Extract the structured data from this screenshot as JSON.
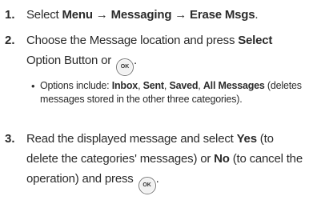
{
  "steps": [
    {
      "number": "1.",
      "prefix": "Select ",
      "path_bold": "Menu → Messaging → Erase Msgs",
      "suffix": "."
    },
    {
      "number": "2.",
      "line1_prefix": "Choose the Message location and press ",
      "line1_bold": "Select",
      "line2_text": "Option Button or ",
      "ok_label": "OK",
      "line2_suffix": ".",
      "bullet": {
        "intro": "Options include: ",
        "opt_inbox": "Inbox",
        "sep1": ", ",
        "opt_sent": "Sent",
        "sep2": ", ",
        "opt_saved": "Saved",
        "sep3": ", ",
        "opt_all": "All Messages",
        "note": " (deletes messages stored in the other three categories)."
      }
    },
    {
      "number": "3.",
      "text1": "Read the displayed message and select ",
      "yes": "Yes",
      "text2": " (to delete the categories' messages) or ",
      "no": "No",
      "text3": " (to cancel the operation) and press ",
      "ok_label": "OK",
      "text4": "."
    }
  ]
}
